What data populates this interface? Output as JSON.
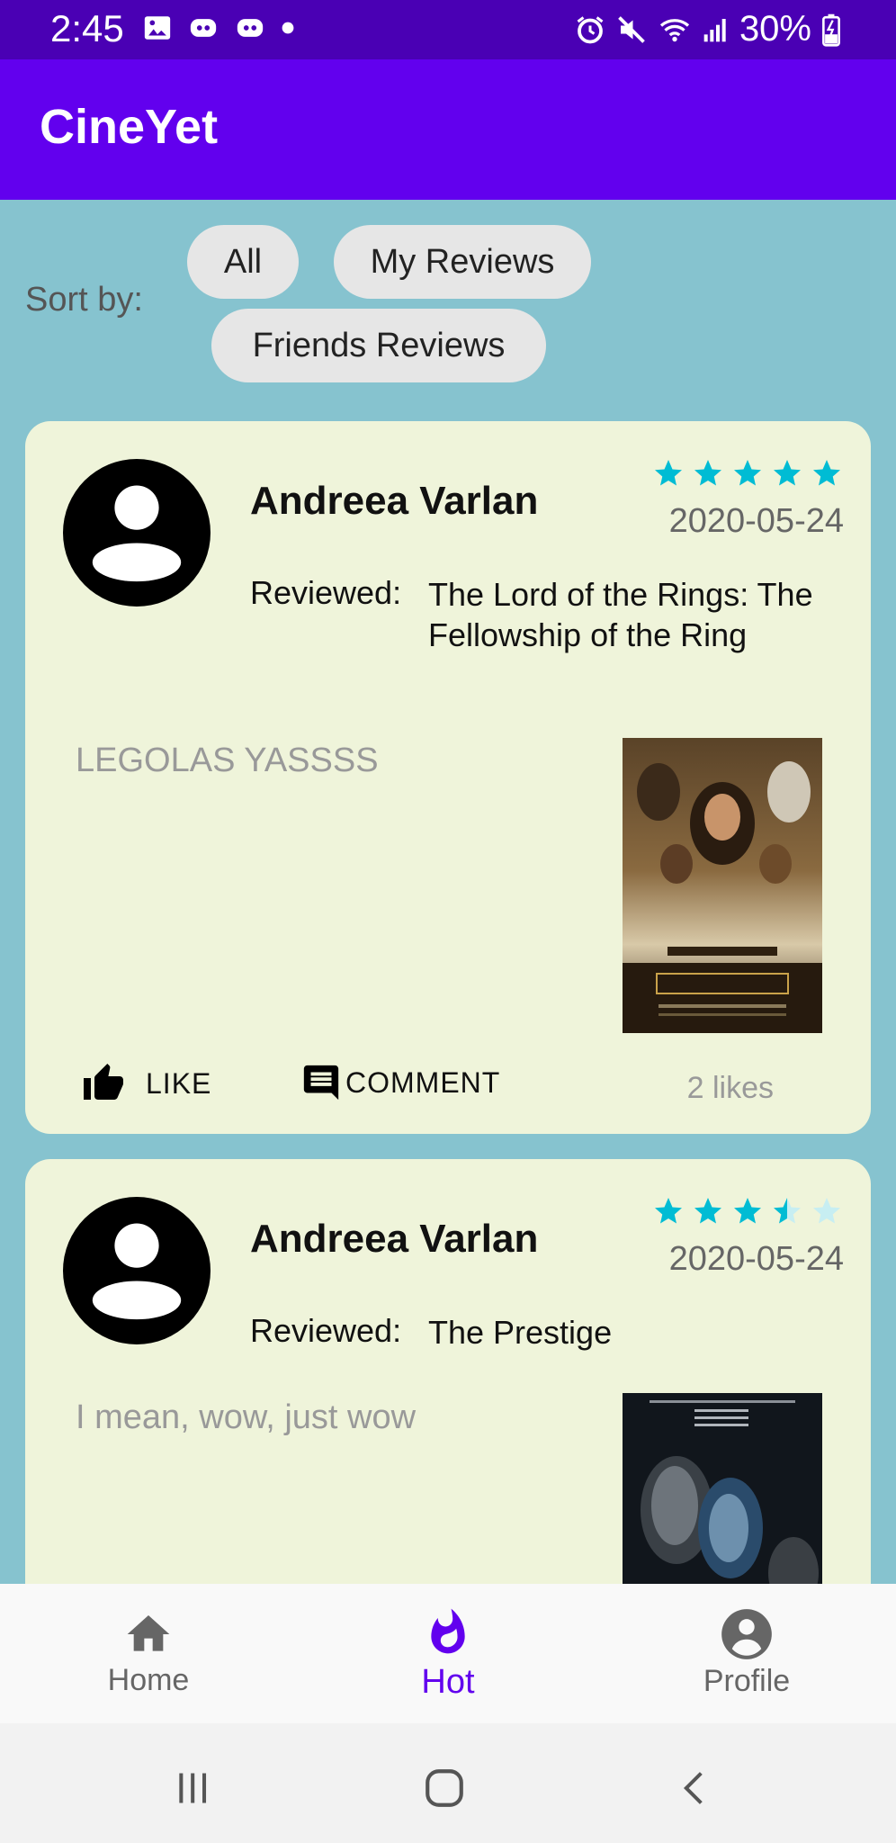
{
  "status_bar": {
    "time": "2:45",
    "battery": "30%"
  },
  "app_bar": {
    "title": "CineYet"
  },
  "sort": {
    "label": "Sort by:",
    "chips": [
      "All",
      "My Reviews",
      "Friends Reviews"
    ]
  },
  "reviews": [
    {
      "reviewer": "Andreea Varlan",
      "date": "2020-05-24",
      "rating": 5,
      "reviewed_label": "Reviewed:",
      "movie": "The Lord of the Rings: The Fellowship of the Ring",
      "comment": "LEGOLAS YASSSS",
      "like_label": "LIKE",
      "comment_label": "COMMENT",
      "likes": "2 likes"
    },
    {
      "reviewer": "Andreea Varlan",
      "date": "2020-05-24",
      "rating": 3.5,
      "reviewed_label": "Reviewed:",
      "movie": "The Prestige",
      "comment": "I mean, wow, just wow"
    }
  ],
  "bottom_nav": {
    "items": [
      "Home",
      "Hot",
      "Profile"
    ],
    "active": "Hot"
  },
  "colors": {
    "primary": "#6200ee",
    "status_bar": "#4a00b4",
    "background": "#86c3cf",
    "card": "#eff4da",
    "star": "#00bcd4"
  }
}
